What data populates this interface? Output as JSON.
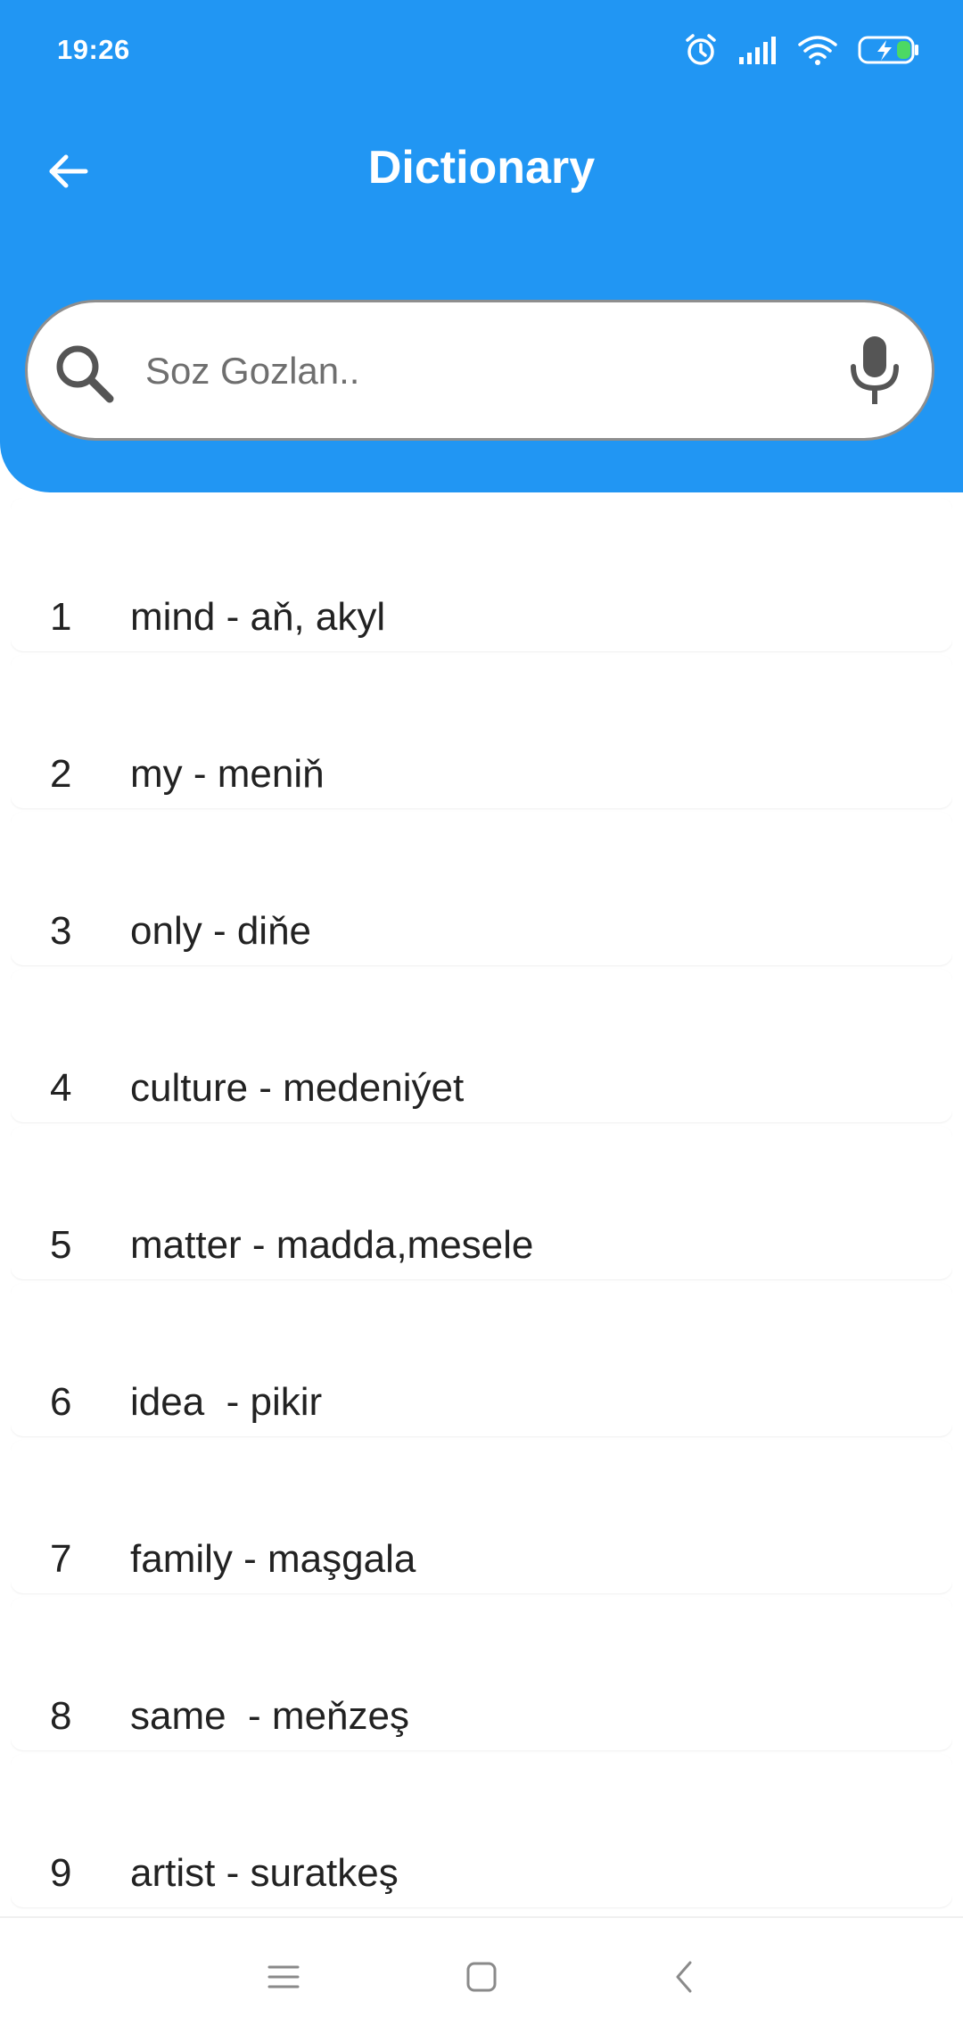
{
  "status_bar": {
    "time": "19:26",
    "icons": [
      "alarm-icon",
      "signal-icon",
      "wifi-icon",
      "battery-charging-icon"
    ]
  },
  "app_bar": {
    "back_icon": "arrow-left-icon",
    "title": "Dictionary"
  },
  "search": {
    "placeholder": "Soz Gozlan..",
    "value": "",
    "search_icon": "search-icon",
    "voice_icon": "mic-icon"
  },
  "words": [
    {
      "number": "1",
      "text": "mind - aň, akyl"
    },
    {
      "number": "2",
      "text": "my - meniň"
    },
    {
      "number": "3",
      "text": "only - diňe"
    },
    {
      "number": "4",
      "text": "culture - medeniýet"
    },
    {
      "number": "5",
      "text": "matter - madda,mesele"
    },
    {
      "number": "6",
      "text": "idea  - pikir"
    },
    {
      "number": "7",
      "text": "family - maşgala"
    },
    {
      "number": "8",
      "text": "same  - meňzeş"
    },
    {
      "number": "9",
      "text": "artist - suratkeş"
    }
  ],
  "nav_bar": {
    "buttons": [
      "menu-icon",
      "home-icon",
      "back-icon"
    ]
  },
  "colors": {
    "primary": "#2196f3",
    "on_primary": "#ffffff",
    "text": "#222222",
    "battery_green": "#4cd964"
  }
}
